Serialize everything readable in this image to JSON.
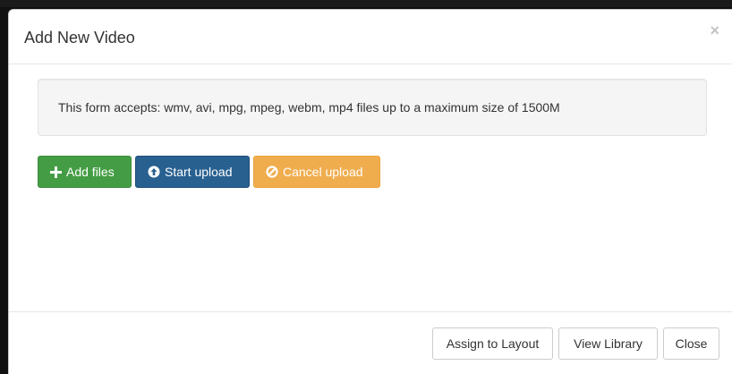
{
  "modal": {
    "title": "Add New Video",
    "close_glyph": "×",
    "info_text": "This form accepts: wmv, avi, mpg, mpeg, webm, mp4 files up to a maximum size of 1500M",
    "buttons": {
      "add_files": "Add files",
      "start_upload": "Start upload",
      "cancel_upload": "Cancel upload"
    },
    "footer": {
      "assign_to_layout": "Assign to Layout",
      "view_library": "View Library",
      "close": "Close"
    }
  },
  "icons": {
    "add_files": "plus-icon",
    "start_upload": "circle-arrow-up-icon",
    "cancel_upload": "ban-circle-icon"
  },
  "colors": {
    "success": "#449d44",
    "primary": "#286090",
    "warning": "#f0ad4e"
  }
}
